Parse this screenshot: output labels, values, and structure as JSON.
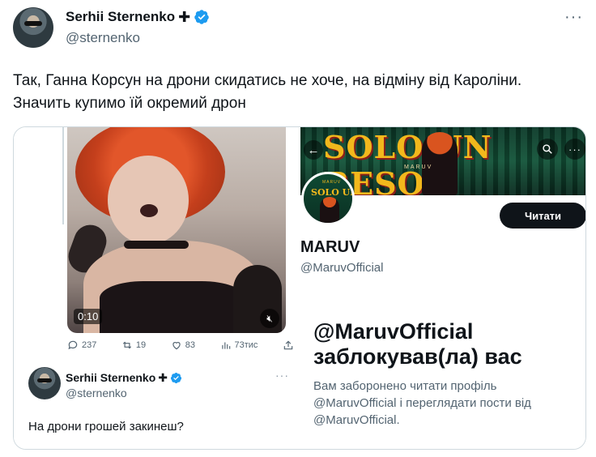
{
  "author": {
    "name": "Serhii Sternenko",
    "handle": "@sternenko",
    "badge_glyph": "✚"
  },
  "tweet": {
    "text_line1": "Так, Ганна Корсун на дрони скидатись не хоче, на відміну від Кароліни.",
    "text_line2": "Значить купимо їй окремий дрон"
  },
  "embedded_left": {
    "video": {
      "timestamp": "0:10"
    },
    "stats": {
      "replies": "237",
      "retweets": "19",
      "likes": "83",
      "views": "73тис"
    },
    "quote": {
      "name": "Serhii Sternenko",
      "handle": "@sternenko",
      "text": "На дрони грошей закинеш?"
    }
  },
  "embedded_right": {
    "banner": {
      "title": "SOLO UN BESO",
      "subtitle": "MARUV"
    },
    "avatar_text": {
      "top": "MARUV",
      "title": "SOLO UN BESO"
    },
    "follow_label": "Читати",
    "profile_name": "MARUV",
    "profile_handle": "@MaruvOfficial",
    "blocked_title_line1": "@MaruvOfficial",
    "blocked_title_line2": "заблокував(ла) вас",
    "blocked_desc_line1": "Вам заборонено читати профіль",
    "blocked_desc_line2": "@MaruvOfficial і переглядати пости від",
    "blocked_desc_line3": "@MaruvOfficial."
  },
  "colors": {
    "verified_blue": "#1d9bf0",
    "text_primary": "#0f1419",
    "text_secondary": "#536471"
  }
}
